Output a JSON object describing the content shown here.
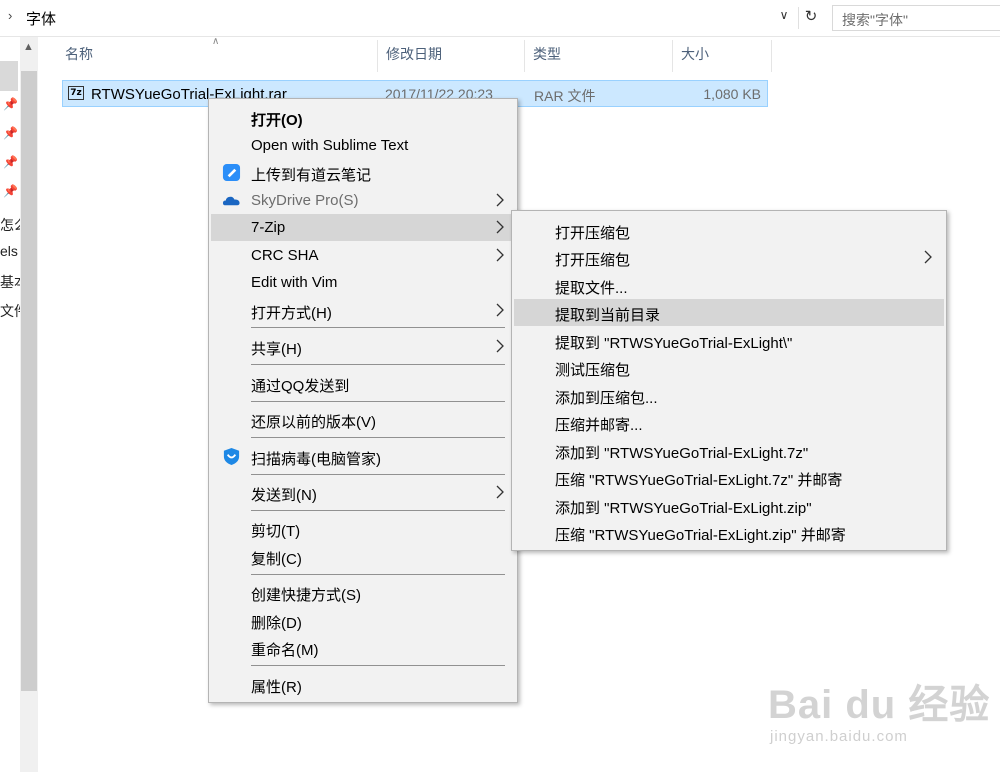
{
  "address": {
    "crumb": "字体",
    "search_placeholder": "搜索\"字体\""
  },
  "nav": {
    "texts": [
      "怎么",
      "els",
      "基本",
      "文件!"
    ]
  },
  "columns": {
    "name": "名称",
    "date": "修改日期",
    "type": "类型",
    "size": "大小"
  },
  "file": {
    "name": "RTWSYueGoTrial-ExLight.rar",
    "date": "2017/11/22 20:23",
    "type": "RAR 文件",
    "size": "1,080 KB",
    "icon_text": "7z"
  },
  "menu": {
    "items": [
      {
        "label": "打开(O)"
      },
      {
        "label": "Open with Sublime Text"
      },
      {
        "label": "上传到有道云笔记"
      },
      {
        "label": "SkyDrive Pro(S)"
      },
      {
        "label": "7-Zip"
      },
      {
        "label": "CRC SHA"
      },
      {
        "label": "Edit with Vim"
      },
      {
        "label": "打开方式(H)"
      },
      {
        "label": "共享(H)"
      },
      {
        "label": "通过QQ发送到"
      },
      {
        "label": "还原以前的版本(V)"
      },
      {
        "label": "扫描病毒(电脑管家)"
      },
      {
        "label": "发送到(N)"
      },
      {
        "label": "剪切(T)"
      },
      {
        "label": "复制(C)"
      },
      {
        "label": "创建快捷方式(S)"
      },
      {
        "label": "删除(D)"
      },
      {
        "label": "重命名(M)"
      },
      {
        "label": "属性(R)"
      }
    ]
  },
  "submenu": {
    "items": [
      {
        "label": "打开压缩包"
      },
      {
        "label": "打开压缩包"
      },
      {
        "label": "提取文件..."
      },
      {
        "label": "提取到当前目录"
      },
      {
        "label": "提取到 \"RTWSYueGoTrial-ExLight\\\""
      },
      {
        "label": "测试压缩包"
      },
      {
        "label": "添加到压缩包..."
      },
      {
        "label": "压缩并邮寄..."
      },
      {
        "label": "添加到 \"RTWSYueGoTrial-ExLight.7z\""
      },
      {
        "label": "压缩 \"RTWSYueGoTrial-ExLight.7z\" 并邮寄"
      },
      {
        "label": "添加到 \"RTWSYueGoTrial-ExLight.zip\""
      },
      {
        "label": "压缩 \"RTWSYueGoTrial-ExLight.zip\" 并邮寄"
      }
    ]
  },
  "watermark": {
    "logo": "Bai du 经验",
    "url": "jingyan.baidu.com"
  },
  "colors": {
    "selection": "#cce8ff",
    "menu_bg": "#f2f2f2",
    "menu_highlight": "#d6d6d6",
    "youdao_blue": "#2b8ef8",
    "tencent_blue": "#1e88e5"
  },
  "icons": {
    "youdao": "youdao-note-icon",
    "skydrive": "onedrive-cloud-icon",
    "guanjia": "tencent-pc-manager-icon"
  }
}
